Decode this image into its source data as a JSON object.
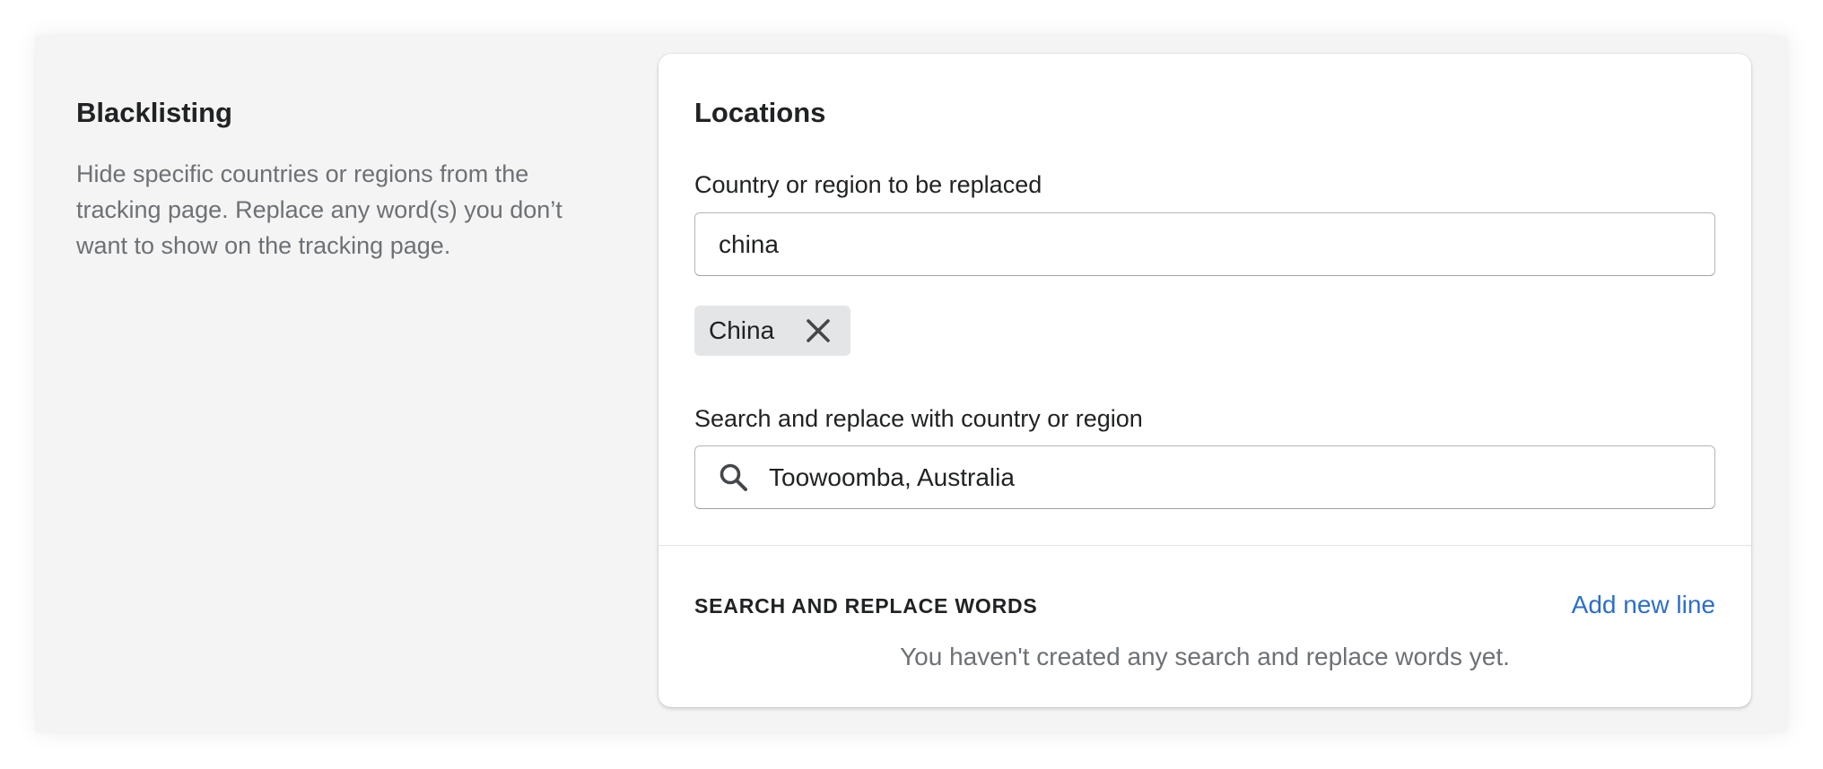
{
  "left_panel": {
    "title": "Blacklisting",
    "description": "Hide specific countries or regions from the tracking page. Replace any word(s) you don’t want to show on the tracking page."
  },
  "card": {
    "title": "Locations",
    "replace_field": {
      "label": "Country or region to be replaced",
      "value": "china"
    },
    "selected_tags": [
      {
        "label": "China",
        "remove_icon": "close-icon"
      }
    ],
    "search_field": {
      "label": "Search and replace with country or region",
      "value": "Toowoomba, Australia",
      "icon": "search-icon"
    },
    "words_section": {
      "heading": "SEARCH AND REPLACE WORDS",
      "add_label": "Add new line",
      "empty_message": "You haven't created any search and replace words yet."
    }
  },
  "colors": {
    "page_background": "#f4f4f4",
    "card_background": "#ffffff",
    "link": "#2c6ecb",
    "tag_background": "#e4e5e7",
    "muted_text": "#6d7175"
  }
}
